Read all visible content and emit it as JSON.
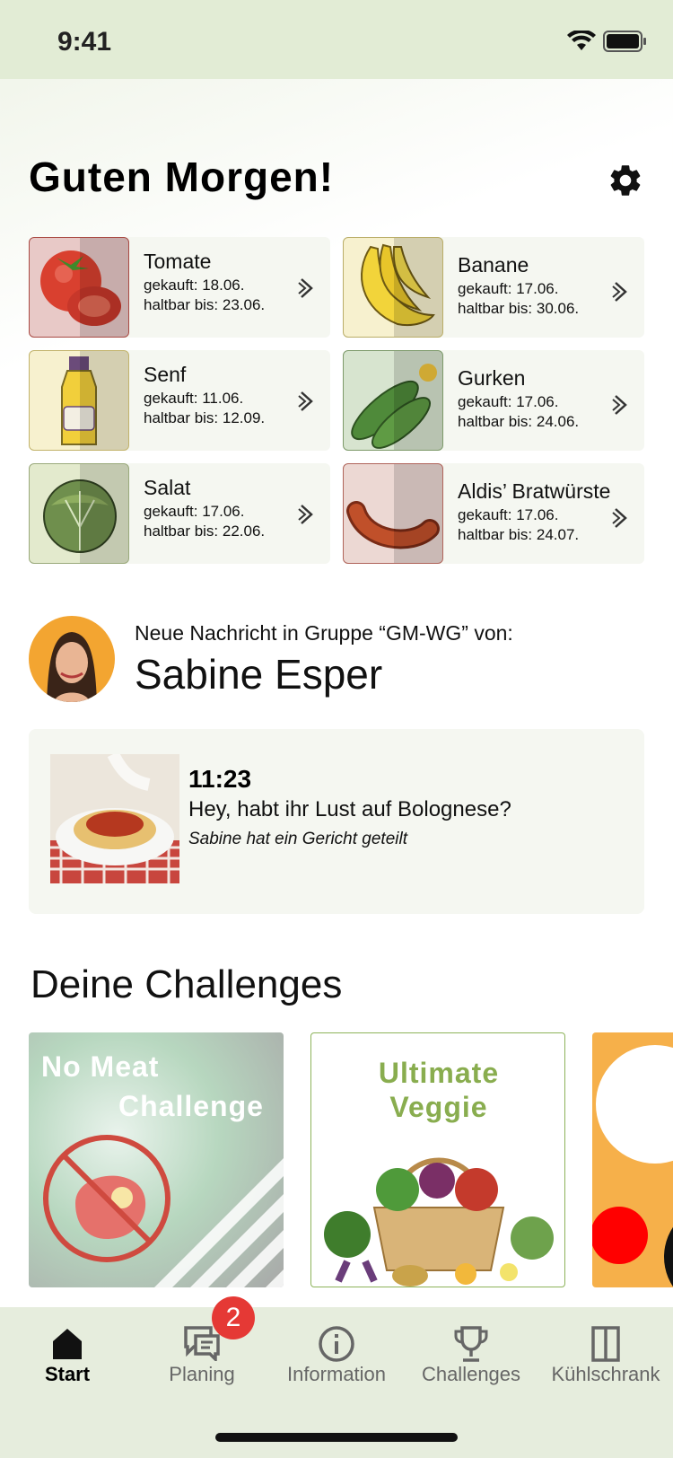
{
  "status": {
    "time": "9:41"
  },
  "header": {
    "greeting": "Guten Morgen!"
  },
  "items": [
    {
      "name": "Tomate",
      "bought": "gekauft: 18.06.",
      "expiry": "haltbar bis: 23.06.",
      "color": "#e8c9c7",
      "border": "#a94a43"
    },
    {
      "name": "Banane",
      "bought": "gekauft: 17.06.",
      "expiry": "haltbar bis: 30.06.",
      "color": "#f7f1cf",
      "border": "#b9ad68"
    },
    {
      "name": "Senf",
      "bought": "gekauft: 11.06.",
      "expiry": "haltbar bis: 12.09.",
      "color": "#f7f1cf",
      "border": "#c2b36b"
    },
    {
      "name": "Gurken",
      "bought": "gekauft: 17.06.",
      "expiry": "haltbar bis: 24.06.",
      "color": "#d7e4cf",
      "border": "#7d9a6a"
    },
    {
      "name": "Salat",
      "bought": "gekauft: 17.06.",
      "expiry": "haltbar bis: 22.06.",
      "color": "#e3eacd",
      "border": "#9aa97b"
    },
    {
      "name": "Aldis’ Bratwürste",
      "bought": "gekauft: 17.06.",
      "expiry": "haltbar bis: 24.07.",
      "color": "#ecd8d3",
      "border": "#b0645a"
    }
  ],
  "message": {
    "intro": "Neue Nachricht in Gruppe “GM-WG” von:",
    "sender": "Sabine Esper",
    "time": "11:23",
    "text": "Hey, habt ihr Lust auf Bolognese?",
    "note": "Sabine hat ein Gericht geteilt"
  },
  "challenges": {
    "heading": "Deine Challenges",
    "cards": [
      {
        "line1": "No Meat",
        "line2": "Challenge"
      },
      {
        "line1": "Ultimate",
        "line2": "Veggie"
      }
    ]
  },
  "tabs": [
    {
      "label": "Start",
      "icon": "home-icon",
      "active": true
    },
    {
      "label": "Planing",
      "icon": "chat-icon",
      "badge": "2"
    },
    {
      "label": "Information",
      "icon": "info-icon"
    },
    {
      "label": "Challenges",
      "icon": "trophy-icon"
    },
    {
      "label": "Kühlschrank",
      "icon": "fridge-icon"
    }
  ]
}
